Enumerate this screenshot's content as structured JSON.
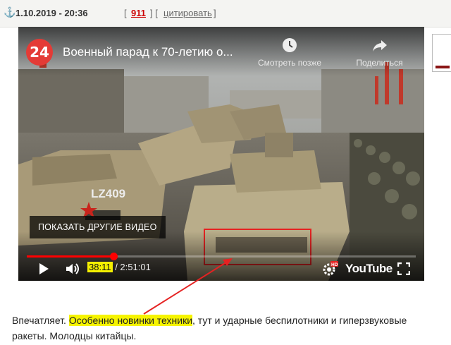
{
  "header": {
    "date": "1.10.2019 - 20:36",
    "reply_count": "911",
    "quote_label": "цитировать",
    "bracket_open": "[",
    "bracket_close": "]",
    "separator": "] ["
  },
  "video": {
    "channel_logo": "24",
    "title": "Военный парад к 70-летию о...",
    "watch_later_label": "Смотреть позже",
    "share_label": "Поделиться",
    "more_videos_label": "ПОКАЗАТЬ ДРУГИЕ ВИДЕО",
    "current_time": "38:11",
    "time_sep": " / ",
    "duration": "2:51:01",
    "progress_fraction": 0.223,
    "youtube_label": "YouTube",
    "hd_badge": "HD",
    "vehicle_marking": "LZ409",
    "annotation_color": "#e52222"
  },
  "comment": {
    "text_before": "Впечатляет. ",
    "highlighted": "Особенно новинки техники",
    "text_after": ", тут и ударные беспилотники и гиперзвуковые ракеты. Молодцы китайцы.",
    "highlight_color": "#f6f400"
  },
  "icons": [
    "anchor-icon",
    "clock-icon",
    "share-icon",
    "play-icon",
    "volume-icon",
    "settings-icon",
    "fullscreen-icon"
  ]
}
